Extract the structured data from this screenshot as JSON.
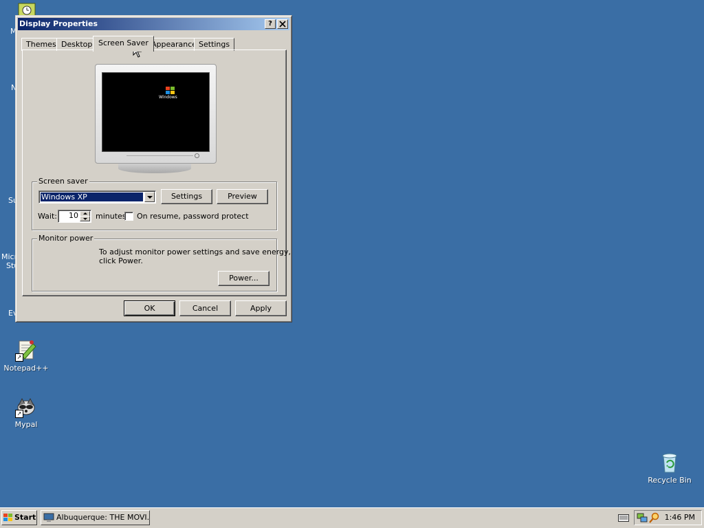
{
  "window": {
    "title": "Display Properties",
    "help_btn": "?",
    "close_btn": "✕"
  },
  "tabs": [
    {
      "label": "Themes"
    },
    {
      "label": "Desktop"
    },
    {
      "label": "Screen Saver",
      "active": true
    },
    {
      "label": "Appearance"
    },
    {
      "label": "Settings"
    }
  ],
  "preview": {
    "logo_text": "Windows"
  },
  "screen_saver": {
    "group_label": "Screen saver",
    "selected": "Windows XP",
    "settings_label": "Settings",
    "preview_label": "Preview",
    "wait_label": "Wait:",
    "wait_value": "10",
    "minutes_label": "minutes",
    "password_label": "On resume, password protect",
    "password_checked": false
  },
  "monitor_power": {
    "group_label": "Monitor power",
    "description_line1": "To adjust monitor power settings and save energy,",
    "description_line2": "click Power.",
    "power_label": "Power..."
  },
  "dialog_buttons": {
    "ok": "OK",
    "cancel": "Cancel",
    "apply": "Apply"
  },
  "desktop_icons": [
    {
      "label": "Notepad++"
    },
    {
      "label": "Mypal"
    },
    {
      "label": "Recycle Bin"
    }
  ],
  "edge_labels": [
    "M",
    "N",
    "Su",
    "Micro",
    "Stu",
    "Ev"
  ],
  "taskbar": {
    "start_label": "Start",
    "task_label": "Albuquerque: THE MOVI...",
    "clock": "1:46 PM"
  },
  "colors": {
    "desktop": "#3a6ea5",
    "titlebar_start": "#0a246a",
    "titlebar_end": "#a6caf0",
    "selection": "#0a246a"
  }
}
